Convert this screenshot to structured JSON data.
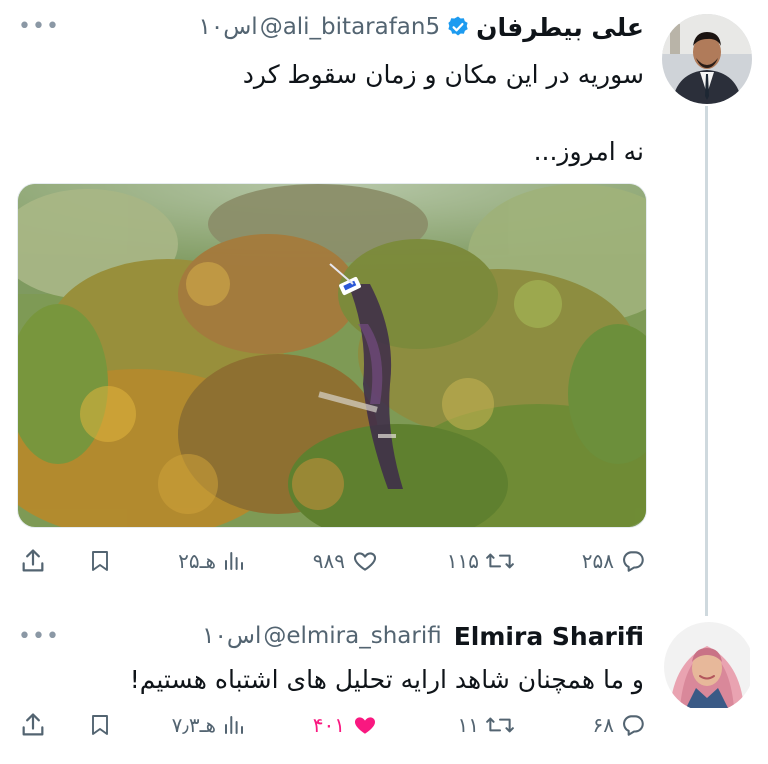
{
  "tweet1": {
    "name": "علی بیطرفان",
    "handle": "@ali_bitarafan5",
    "time": "۱۰اس",
    "line1": "سوریه در این مکان و زمان سقوط کرد",
    "line2": "نه امروز...",
    "media_icon": "crash-site-photo",
    "actions": {
      "replies": "۲۵۸",
      "retweets": "۱۱۵",
      "likes": "۹۸۹",
      "views": "۲۵هـ"
    }
  },
  "tweet2": {
    "name": "Elmira Sharifi",
    "handle": "@elmira_sharifi",
    "time": "۱۰اس",
    "text": "و ما همچنان شاهد ارایه تحلیل های اشتباه هستیم!",
    "liked": true,
    "actions": {
      "replies": "۶۸",
      "retweets": "۱۱",
      "likes": "۴۰۱",
      "views": "۷٫۳هـ"
    }
  },
  "colors": {
    "verified": "#1d9bf0",
    "like_active": "#f91880",
    "secondary_text": "#536471",
    "thread_line": "#cfd9de"
  }
}
